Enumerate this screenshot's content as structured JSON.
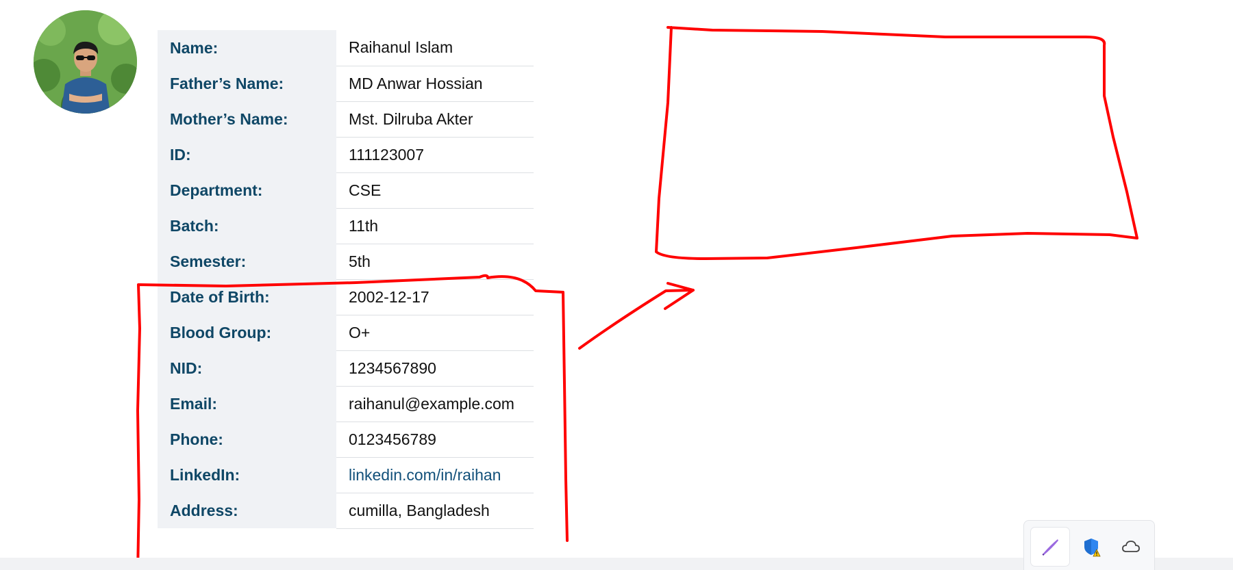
{
  "profile": {
    "rows": [
      {
        "label": "Name:",
        "value": "Raihanul Islam"
      },
      {
        "label": "Father’s Name:",
        "value": "MD Anwar Hossian"
      },
      {
        "label": "Mother’s Name:",
        "value": "Mst. Dilruba Akter"
      },
      {
        "label": "ID:",
        "value": "111123007"
      },
      {
        "label": "Department:",
        "value": "CSE"
      },
      {
        "label": "Batch:",
        "value": "11th"
      },
      {
        "label": "Semester:",
        "value": "5th"
      },
      {
        "label": "Date of Birth:",
        "value": "2002-12-17"
      },
      {
        "label": "Blood Group:",
        "value": "O+"
      },
      {
        "label": "NID:",
        "value": "1234567890"
      },
      {
        "label": "Email:",
        "value": "raihanul@example.com"
      },
      {
        "label": "Phone:",
        "value": "0123456789"
      },
      {
        "label": "LinkedIn:",
        "value": "linkedin.com/in/raihan"
      },
      {
        "label": "Address:",
        "value": "cumilla, Bangladesh"
      }
    ]
  },
  "colors": {
    "label_text": "#0f4766",
    "label_bg": "#f0f2f5",
    "link": "#12507a",
    "annotation": "#ff0000"
  },
  "tray": {
    "icons": [
      "pen-icon",
      "shield-warning-icon",
      "cloud-icon"
    ]
  }
}
